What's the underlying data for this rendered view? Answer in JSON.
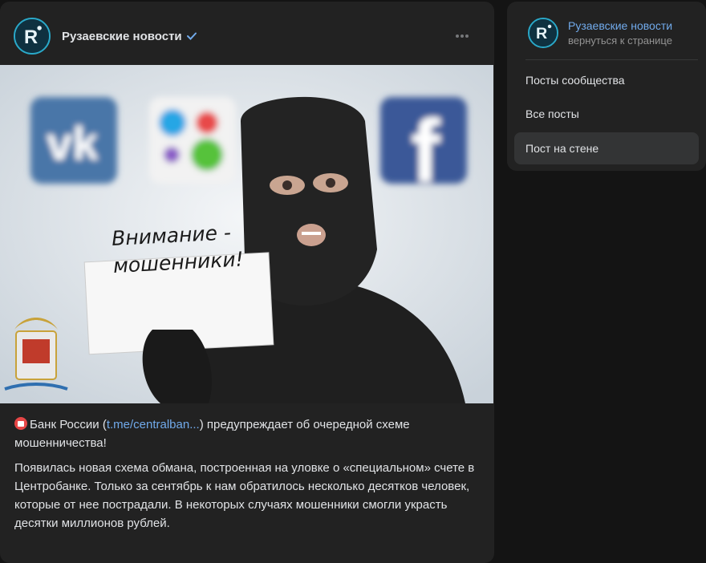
{
  "post": {
    "author": "Рузаевские новости",
    "verified_icon": "verified-check-icon",
    "more_icon": "more-horizontal-icon",
    "image": {
      "sign_line1": "Внимание -",
      "sign_line2": "мошенники!"
    },
    "text": {
      "p1_prefix": "Банк России (",
      "p1_link": "t.me/centralban...",
      "p1_suffix": ") предупреждает об очередной схеме мошенничества!",
      "p2": "Появилась новая схема обмана, построенная на уловке о «специальном» счете в Центробанке. Только за сентябрь к нам обратилось несколько десятков человек, которые от нее пострадали. В некоторых случаях мошенники смогли украсть десятки миллионов рублей."
    }
  },
  "sidebar": {
    "title": "Рузаевские новости",
    "subtitle": "вернуться к странице",
    "items": [
      {
        "label": "Посты сообщества",
        "active": false
      },
      {
        "label": "Все посты",
        "active": false
      },
      {
        "label": "Пост на стене",
        "active": true
      }
    ]
  },
  "colors": {
    "accent": "#71aaeb",
    "card": "#222222",
    "background": "#141414"
  }
}
